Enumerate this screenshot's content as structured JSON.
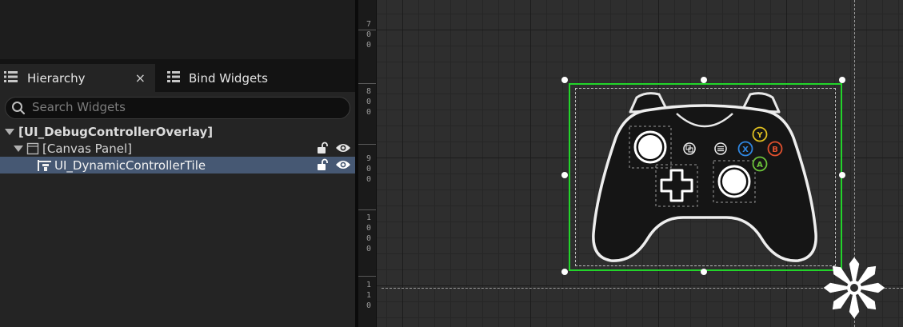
{
  "hierarchy_panel": {
    "tabs": [
      {
        "label": "Hierarchy",
        "icon": "hierarchy-list-icon",
        "active": true
      },
      {
        "label": "Bind Widgets",
        "icon": "bind-widgets-icon",
        "active": false
      }
    ],
    "close_glyph": "×",
    "search": {
      "placeholder": "Search Widgets",
      "value": ""
    },
    "tree": [
      {
        "label": "[UI_DebugControllerOverlay]",
        "depth": 0,
        "expanded": true,
        "bold": true,
        "selected": false
      },
      {
        "label": "[Canvas Panel]",
        "depth": 1,
        "expanded": true,
        "bold": false,
        "selected": false,
        "locked": false,
        "visible": true
      },
      {
        "label": "UI_DynamicControllerTile",
        "depth": 2,
        "bold": false,
        "selected": true,
        "locked": false,
        "visible": true
      }
    ]
  },
  "designer": {
    "ruler_labels": [
      "7\n0\n0",
      "8\n0\n0",
      "9\n0\n0",
      "1\n0\n0\n0",
      "1\n1\n0"
    ],
    "selection_color": "#22d42a",
    "controller": {
      "face_buttons": [
        {
          "label": "Y",
          "color": "#e0c020"
        },
        {
          "label": "B",
          "color": "#e0502e"
        },
        {
          "label": "X",
          "color": "#2f86e0"
        },
        {
          "label": "A",
          "color": "#6cc43a"
        }
      ]
    }
  }
}
